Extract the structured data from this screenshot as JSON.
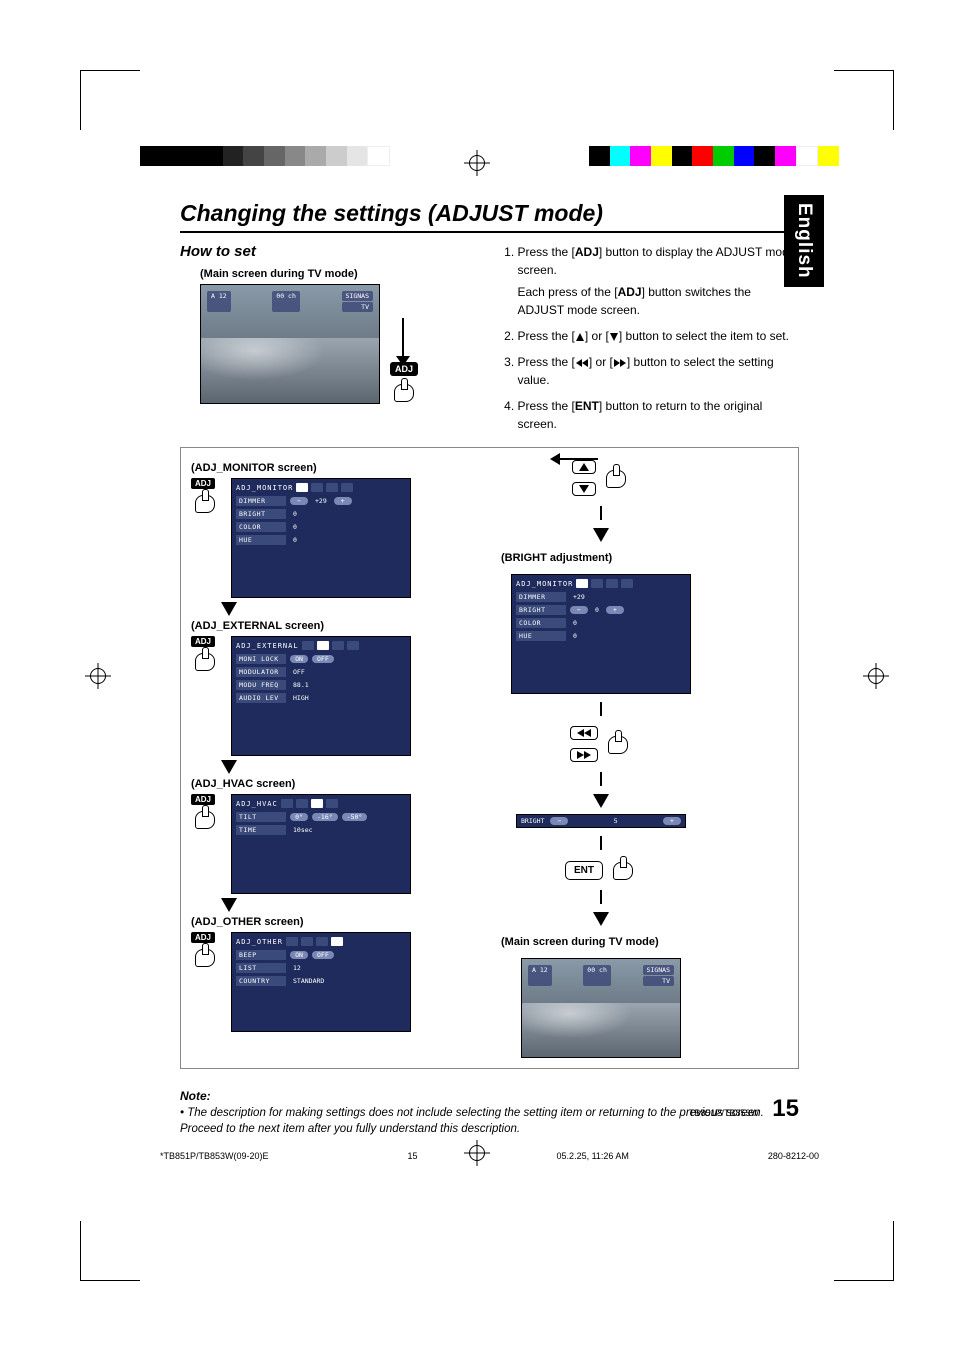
{
  "domain": "Document",
  "title": "Changing the settings (ADJUST mode)",
  "howto_heading": "How to set",
  "language_tab": "English",
  "captions": {
    "main_tv": "(Main screen during TV mode)",
    "adj_monitor": "(ADJ_MONITOR screen)",
    "adj_external": "(ADJ_EXTERNAL screen)",
    "adj_hvac": "(ADJ_HVAC screen)",
    "adj_other": "(ADJ_OTHER screen)",
    "bright_adj": "(BRIGHT adjustment)",
    "main_tv2": "(Main screen during TV mode)"
  },
  "tv": {
    "left1": "A 12",
    "left2": "00 ch",
    "right1": "SIGNAS",
    "right2": "TV"
  },
  "screens": {
    "monitor": {
      "header": "ADJ_MONITOR",
      "rows": [
        {
          "label": "DIMMER",
          "left": "−",
          "value": "+29",
          "right": "+"
        },
        {
          "label": "BRIGHT",
          "value": "0"
        },
        {
          "label": "COLOR",
          "value": "0"
        },
        {
          "label": "HUE",
          "value": "0"
        }
      ]
    },
    "external": {
      "header": "ADJ_EXTERNAL",
      "rows": [
        {
          "label": "MONI LOCK",
          "opts": [
            "ON",
            "OFF"
          ]
        },
        {
          "label": "MODULATOR",
          "value": "OFF"
        },
        {
          "label": "MODU FREQ",
          "value": "88.1"
        },
        {
          "label": "AUDIO LEV",
          "value": "HIGH"
        }
      ]
    },
    "hvac": {
      "header": "ADJ_HVAC",
      "rows": [
        {
          "label": "TILT",
          "opts": [
            "0°",
            "-16°",
            "-50°"
          ]
        },
        {
          "label": "TIME",
          "value": "10sec"
        }
      ]
    },
    "other": {
      "header": "ADJ_OTHER",
      "rows": [
        {
          "label": "BEEP",
          "opts": [
            "ON",
            "OFF"
          ]
        },
        {
          "label": "LIST",
          "value": "12"
        },
        {
          "label": "COUNTRY",
          "value": "STANDARD"
        }
      ]
    },
    "bright_monitor": {
      "header": "ADJ_MONITOR",
      "rows": [
        {
          "label": "DIMMER",
          "value": "+29"
        },
        {
          "label": "BRIGHT",
          "left": "−",
          "value": "0",
          "right": "+"
        },
        {
          "label": "COLOR",
          "value": "0"
        },
        {
          "label": "HUE",
          "value": "0"
        }
      ]
    },
    "bright_bar": {
      "label": "BRIGHT",
      "left": "−",
      "value": "5",
      "right": "+"
    }
  },
  "steps": [
    {
      "pre": "Press the [",
      "key": "ADJ",
      "post": "] button to display the ADJUST mode screen.",
      "sub_pre": "Each press of the [",
      "sub_key": "ADJ",
      "sub_post": "] button switches the ADJUST mode screen."
    },
    {
      "pre": "Press the [",
      "icon": "up",
      "mid": "] or [",
      "icon2": "down",
      "post": "] button to select the item to set."
    },
    {
      "pre": "Press the [",
      "icon": "rw",
      "mid": "] or [",
      "icon2": "ff",
      "post": "] button to select the setting value."
    },
    {
      "pre": "Press the [",
      "key": "ENT",
      "post": "] button to return to the original screen."
    }
  ],
  "adj_label": "ADJ",
  "ent_label": "ENT",
  "note_heading": "Note:",
  "note_body": "• The description for making settings does not include selecting the setting item or returning to the previous screen. Proceed to the next item after you fully understand this description.",
  "page_number": "15",
  "model": "TB851P/TB853W",
  "footer": {
    "file": "*TB851P/TB853W(09-20)E",
    "page": "15",
    "date": "05.2.25, 11:26 AM",
    "code": "280-8212-00"
  }
}
